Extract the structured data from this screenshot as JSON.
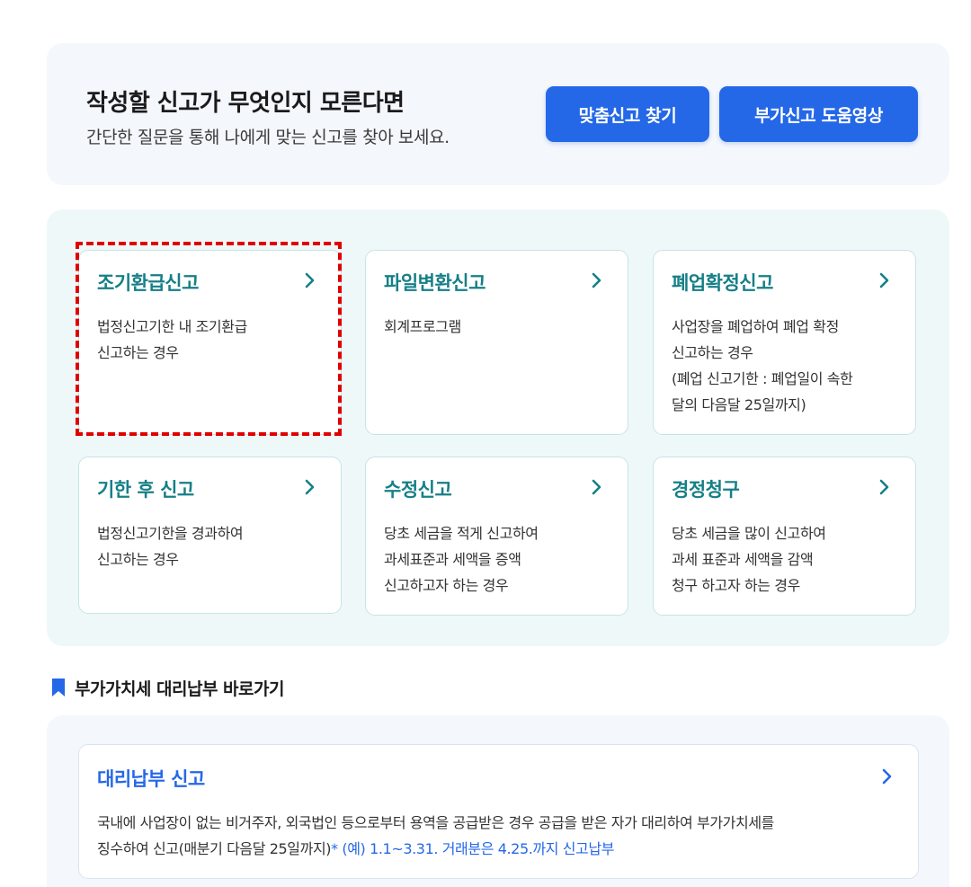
{
  "hero": {
    "title": "작성할 신고가 무엇인지 모른다면",
    "subtitle": "간단한 질문을 통해 나에게 맞는 신고를 찾아 보세요.",
    "buttons": [
      "맞춤신고 찾기",
      "부가신고 도움영상"
    ]
  },
  "cards": [
    {
      "title": "조기환급신고",
      "lines": [
        "법정신고기한 내 조기환급",
        "신고하는 경우"
      ],
      "highlighted": true
    },
    {
      "title": "파일변환신고",
      "lines": [
        "회계프로그램"
      ]
    },
    {
      "title": "폐업확정신고",
      "lines": [
        "사업장을 폐업하여 폐업 확정",
        "신고하는 경우",
        "(폐업 신고기한 : 폐업일이 속한",
        "달의 다음달 25일까지)"
      ]
    },
    {
      "title": "기한 후 신고",
      "lines": [
        "법정신고기한을 경과하여",
        "신고하는 경우"
      ]
    },
    {
      "title": "수정신고",
      "lines": [
        "당초 세금을 적게 신고하여",
        "과세표준과 세액을 증액",
        "신고하고자 하는 경우"
      ]
    },
    {
      "title": "경정청구",
      "lines": [
        "당초 세금을 많이 신고하여",
        "과세 표준과 세액을 감액",
        "청구 하고자 하는 경우"
      ]
    }
  ],
  "section": {
    "title": "부가가치세 대리납부 바로가기",
    "icon": "bookmark-icon"
  },
  "proxy_card": {
    "title": "대리납부 신고",
    "line1": "국내에 사업장이 없는 비거주자, 외국법인 등으로부터 용역을 공급받은 경우 공급을 받은 자가 대리하여 부가가치세를",
    "line2": "징수하여 신고(매분기 다음달 25일까지)",
    "note": "* (예) 1.1~3.31. 거래분은 4.25.까지 신고납부"
  },
  "colors": {
    "primary": "#2468e8",
    "teal_title": "#167f87",
    "highlight_border": "#e00000"
  }
}
